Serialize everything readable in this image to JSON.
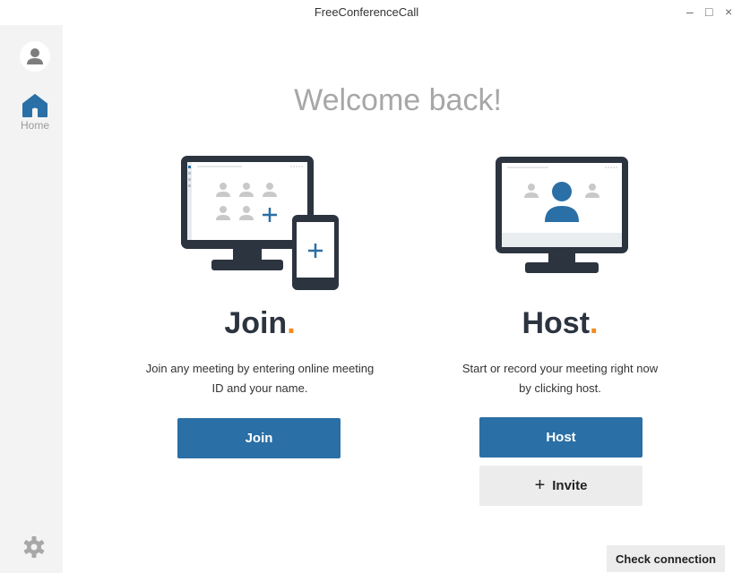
{
  "window": {
    "title": "FreeConferenceCall",
    "minimize_glyph": "–",
    "maximize_glyph": "□",
    "close_glyph": "×"
  },
  "sidebar": {
    "avatar_icon": "user-icon",
    "home_icon": "home-icon",
    "home_label": "Home",
    "settings_icon": "gear-icon"
  },
  "main": {
    "welcome": "Welcome back!",
    "join": {
      "title": "Join",
      "title_dot": ".",
      "description_line1": "Join any meeting by entering online meeting",
      "description_line2": "ID and your name.",
      "button_label": "Join"
    },
    "host": {
      "title": "Host",
      "title_dot": ".",
      "description_line1": "Start or record your meeting right now",
      "description_line2": "by clicking host.",
      "button_label": "Host",
      "invite_label": "Invite",
      "invite_glyph": "+"
    },
    "check_connection_label": "Check connection"
  },
  "colors": {
    "primary": "#2a6fa6",
    "accent_dot": "#f28b1f",
    "dark": "#2c3440",
    "sidebar_bg": "#f3f3f3",
    "welcome_text": "#a7a7a7"
  }
}
